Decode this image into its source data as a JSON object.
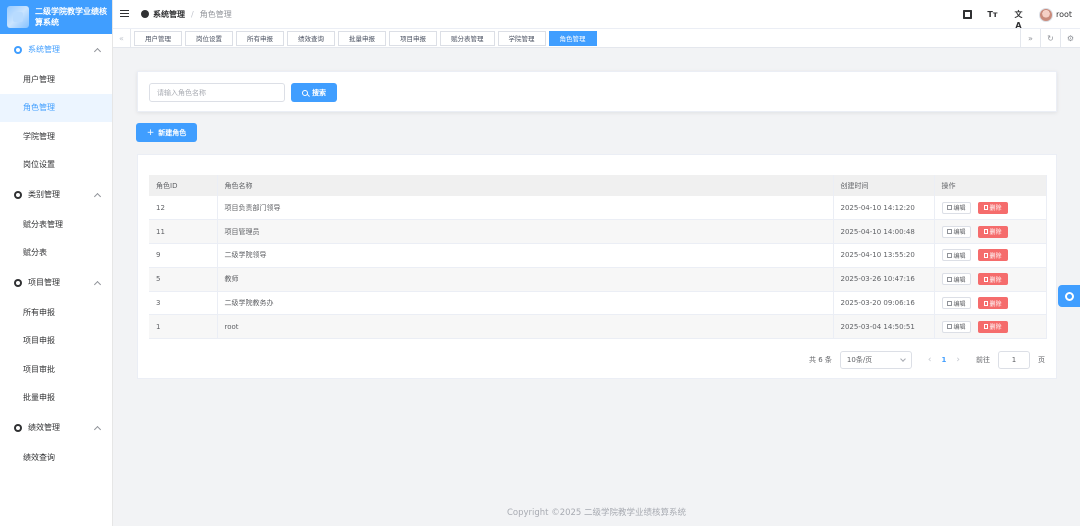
{
  "app": {
    "title": "二级学院教学业绩核算系统"
  },
  "sidebar": {
    "groups": [
      {
        "label": "系统管理",
        "active": true,
        "items": [
          {
            "label": "用户管理"
          },
          {
            "label": "角色管理",
            "active": true
          },
          {
            "label": "学院管理"
          },
          {
            "label": "岗位设置"
          }
        ]
      },
      {
        "label": "类别管理",
        "items": [
          {
            "label": "赋分表管理"
          },
          {
            "label": "赋分表"
          }
        ]
      },
      {
        "label": "项目管理",
        "items": [
          {
            "label": "所有申报"
          },
          {
            "label": "项目申报"
          },
          {
            "label": "项目审批"
          },
          {
            "label": "批量申报"
          }
        ]
      },
      {
        "label": "绩效管理",
        "items": [
          {
            "label": "绩效查询"
          }
        ]
      }
    ]
  },
  "header": {
    "breadcrumb": [
      "系统管理",
      "角色管理"
    ],
    "separator": "/",
    "user": "root",
    "icons": [
      "fullscreen-icon",
      "font-size-icon",
      "translate-icon"
    ]
  },
  "tags": {
    "items": [
      "用户管理",
      "岗位设置",
      "所有申报",
      "绩效查询",
      "批量申报",
      "项目申报",
      "赋分表管理",
      "学院管理",
      "角色管理"
    ],
    "active_index": 8
  },
  "search": {
    "placeholder": "请输入角色名称",
    "button_label": "搜索"
  },
  "toolbar": {
    "new_label": "新建角色"
  },
  "table": {
    "columns": [
      "角色ID",
      "角色名称",
      "创建时间",
      "操作"
    ],
    "rows": [
      {
        "id": "12",
        "name": "项目负责部门领导",
        "created": "2025-04-10 14:12:20"
      },
      {
        "id": "11",
        "name": "项目管理员",
        "created": "2025-04-10 14:00:48"
      },
      {
        "id": "9",
        "name": "二级学院领导",
        "created": "2025-04-10 13:55:20"
      },
      {
        "id": "5",
        "name": "教师",
        "created": "2025-03-26 10:47:16"
      },
      {
        "id": "3",
        "name": "二级学院教务办",
        "created": "2025-03-20 09:06:16"
      },
      {
        "id": "1",
        "name": "root",
        "created": "2025-03-04 14:50:51"
      }
    ],
    "edit_label": "编辑",
    "delete_label": "删除"
  },
  "pagination": {
    "total_text": "共 6 条",
    "page_size": "10条/页",
    "current_page": "1",
    "goto_label": "前往",
    "goto_value": "1",
    "page_suffix": "页"
  },
  "footer": {
    "text": "Copyright ©2025 二级学院教学业绩核算系统"
  },
  "colors": {
    "primary": "#409eff",
    "danger": "#f56c6c"
  }
}
